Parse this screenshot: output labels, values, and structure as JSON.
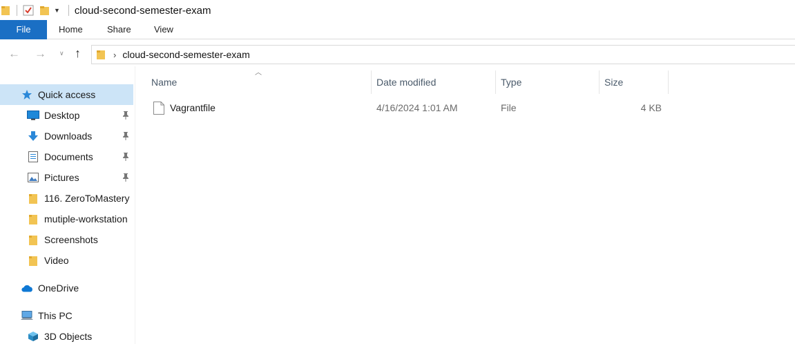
{
  "window": {
    "title": "cloud-second-semester-exam"
  },
  "ribbon": {
    "tabs": [
      "File",
      "Home",
      "Share",
      "View"
    ]
  },
  "address": {
    "path": [
      "cloud-second-semester-exam"
    ]
  },
  "nav": {
    "quick_access": "Quick access",
    "items": [
      {
        "label": "Desktop",
        "icon": "desktop-icon",
        "pinned": true
      },
      {
        "label": "Downloads",
        "icon": "download-arrow-icon",
        "pinned": true
      },
      {
        "label": "Documents",
        "icon": "documents-icon",
        "pinned": true
      },
      {
        "label": "Pictures",
        "icon": "pictures-icon",
        "pinned": true
      },
      {
        "label": "116. ZeroToMastery",
        "icon": "folder-icon",
        "pinned": false
      },
      {
        "label": "mutiple-workstation",
        "icon": "folder-icon",
        "pinned": false
      },
      {
        "label": "Screenshots",
        "icon": "folder-icon",
        "pinned": false
      },
      {
        "label": "Video",
        "icon": "folder-icon",
        "pinned": false
      }
    ],
    "onedrive": "OneDrive",
    "this_pc": "This PC",
    "objects_3d": "3D Objects"
  },
  "columns": {
    "name": "Name",
    "date": "Date modified",
    "type": "Type",
    "size": "Size"
  },
  "files": [
    {
      "name": "Vagrantfile",
      "date": "4/16/2024 1:01 AM",
      "type": "File",
      "size": "4 KB"
    }
  ],
  "colors": {
    "accent": "#1a6fc4",
    "selected": "#cce4f7",
    "folder": "#f2c453"
  }
}
